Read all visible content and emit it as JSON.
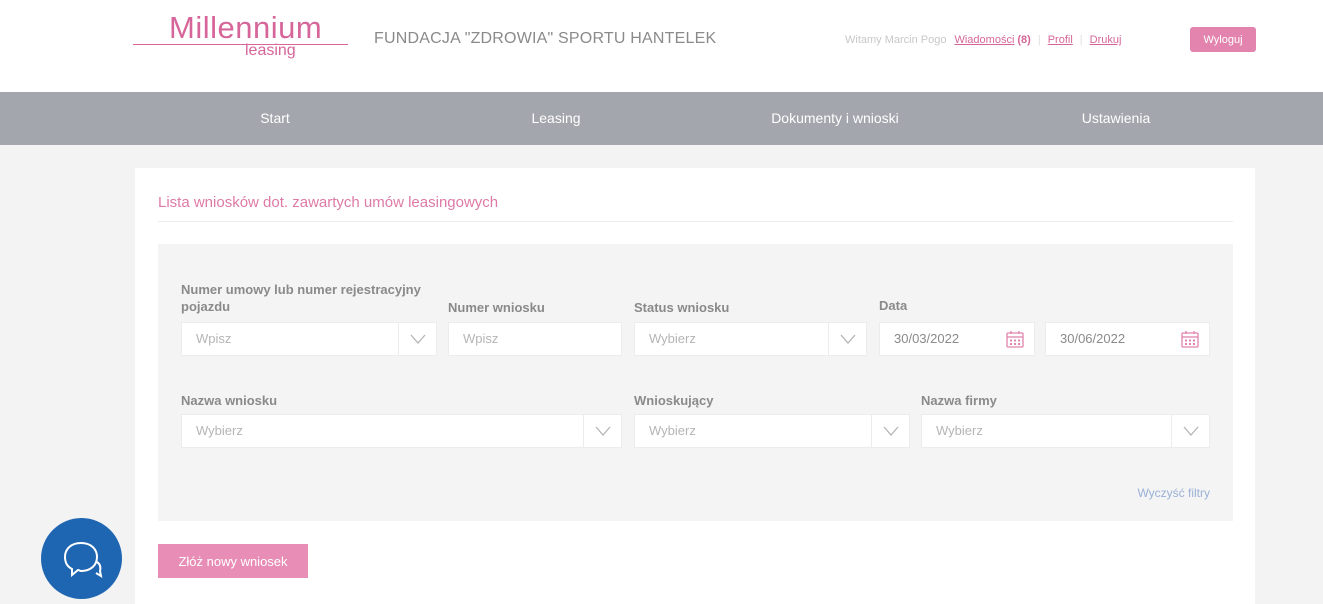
{
  "logo": {
    "main": "Millennium",
    "sub": "leasing"
  },
  "company_name": "FUNDACJA \"ZDROWIA\" SPORTU HANTELEK",
  "user_bar": {
    "greeting": "Witamy Marcin Pogo",
    "messages_label": "Wiadomości",
    "messages_count": "(8)",
    "profile_label": "Profil",
    "print_label": "Drukuj",
    "logout_label": "Wyloguj"
  },
  "nav": {
    "items": [
      {
        "label": "Start"
      },
      {
        "label": "Leasing"
      },
      {
        "label": "Dokumenty i wnioski"
      },
      {
        "label": "Ustawienia"
      }
    ]
  },
  "panel": {
    "title": "Lista wniosków dot. zawartych umów leasingowych",
    "filters": {
      "contract_number": {
        "label": "Numer umowy lub numer rejestracyjny pojazdu",
        "placeholder": "Wpisz"
      },
      "request_number": {
        "label": "Numer wniosku",
        "placeholder": "Wpisz"
      },
      "status": {
        "label": "Status wniosku",
        "placeholder": "Wybierz"
      },
      "date": {
        "label": "Data",
        "from": "30/03/2022",
        "to": "30/06/2022"
      },
      "request_name": {
        "label": "Nazwa wniosku",
        "placeholder": "Wybierz"
      },
      "applicant": {
        "label": "Wnioskujący",
        "placeholder": "Wybierz"
      },
      "company_name": {
        "label": "Nazwa firmy",
        "placeholder": "Wybierz"
      },
      "clear_label": "Wyczyść filtry"
    },
    "new_request_label": "Złóż nowy wniosek"
  },
  "colors": {
    "brand_pink": "#d6669a",
    "nav_gray": "#a3a6ac",
    "chat_blue": "#1f66b2",
    "link_blue": "#9ab0d6"
  },
  "icons": [
    "chevron-down-icon",
    "calendar-icon",
    "chat-icon"
  ]
}
